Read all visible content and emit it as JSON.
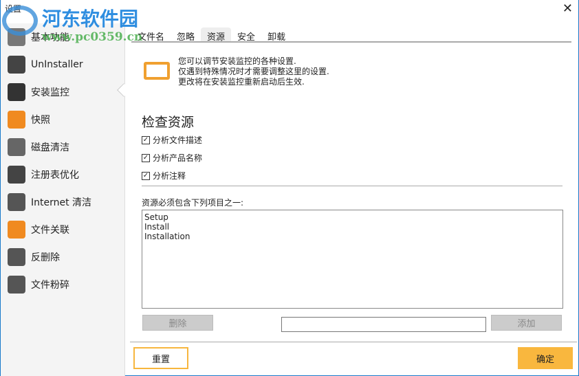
{
  "window": {
    "title": "设置",
    "close": "✕"
  },
  "watermark": {
    "name": "河东软件园",
    "url": "www.pc0359.cn"
  },
  "sidebar": {
    "items": [
      {
        "label": "基本功能",
        "icon": "gear-icon",
        "color": "#777"
      },
      {
        "label": "UnInstaller",
        "icon": "uninstaller-icon",
        "color": "#444"
      },
      {
        "label": "安装监控",
        "icon": "monitor-icon",
        "color": "#333"
      },
      {
        "label": "快照",
        "icon": "snapshot-icon",
        "color": "#f08a20"
      },
      {
        "label": "磁盘清洁",
        "icon": "disk-icon",
        "color": "#666"
      },
      {
        "label": "注册表优化",
        "icon": "registry-icon",
        "color": "#444"
      },
      {
        "label": "Internet 清洁",
        "icon": "globe-icon",
        "color": "#555"
      },
      {
        "label": "文件关联",
        "icon": "link-icon",
        "color": "#f08a20"
      },
      {
        "label": "反删除",
        "icon": "undelete-icon",
        "color": "#555"
      },
      {
        "label": "文件粉碎",
        "icon": "shredder-icon",
        "color": "#555"
      }
    ]
  },
  "tabs": [
    {
      "label": "文件名"
    },
    {
      "label": "忽略"
    },
    {
      "label": "资源"
    },
    {
      "label": "安全"
    },
    {
      "label": "卸载"
    }
  ],
  "info": [
    "您可以调节安装监控的各种设置.",
    "仅遇到特殊情况时才需要调整这里的设置.",
    "更改将在安装监控重新启动后生效."
  ],
  "section": {
    "title": "检查资源",
    "checkboxes": [
      {
        "label": "分析文件描述",
        "checked": true
      },
      {
        "label": "分析产品名称",
        "checked": true
      },
      {
        "label": "分析注释",
        "checked": true
      }
    ],
    "list_label": "资源必须包含下列项目之一:",
    "list": [
      "Setup",
      "Install",
      "Installation"
    ],
    "delete": "删除",
    "add": "添加",
    "input_value": ""
  },
  "footer": {
    "reset": "重置",
    "ok": "确定"
  }
}
